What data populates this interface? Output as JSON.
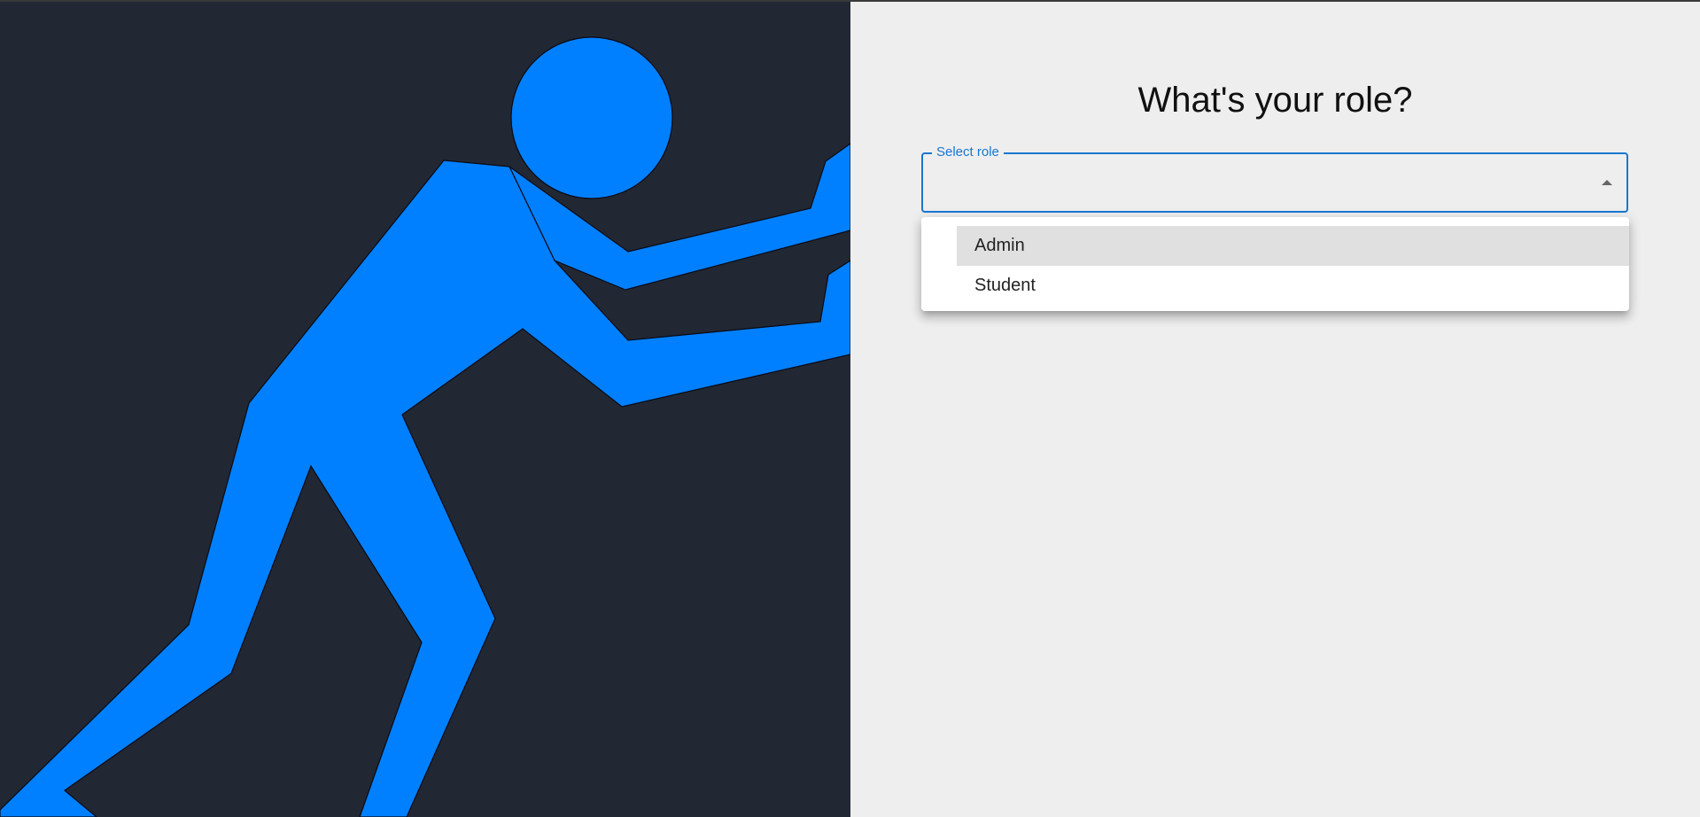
{
  "heading": "What's your role?",
  "role_select": {
    "label": "Select role",
    "value": "",
    "options": [
      {
        "label": "Admin",
        "highlighted": true
      },
      {
        "label": "Student",
        "highlighted": false
      }
    ]
  },
  "illustration": {
    "subject": "pushing-figure",
    "figure_color": "#0080ff",
    "background_color": "#222833"
  },
  "colors": {
    "accent": "#1976d2",
    "panel_background": "#eeeeee"
  }
}
